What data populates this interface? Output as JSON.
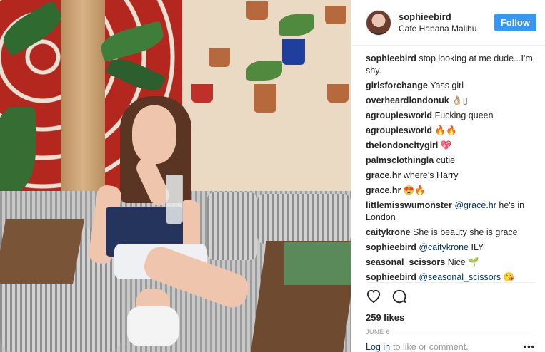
{
  "header": {
    "username": "sophieebird",
    "location": "Cafe Habana Malibu",
    "follow_label": "Follow"
  },
  "comments": [
    {
      "user": "sophieebird",
      "text": "stop looking at me dude...I'm shy."
    },
    {
      "user": "girlsforchange",
      "text": "Yass girl"
    },
    {
      "user": "overheardlondonuk",
      "text": "👌🏼▯"
    },
    {
      "user": "agroupiesworld",
      "text": "Fucking queen"
    },
    {
      "user": "agroupiesworld",
      "text": "🔥🔥"
    },
    {
      "user": "thelondoncitygirl",
      "text": "💖"
    },
    {
      "user": "palmsclothingla",
      "text": "cutie"
    },
    {
      "user": "grace.hr",
      "text": "where's Harry"
    },
    {
      "user": "grace.hr",
      "text": "😍🔥"
    },
    {
      "user": "littlemisswumonster",
      "mention": "@grace.hr",
      "text": "he's in London"
    },
    {
      "user": "caitykrone",
      "text": "She is beauty she is grace"
    },
    {
      "user": "sophieebird",
      "mention": "@caitykrone",
      "text": "ILY"
    },
    {
      "user": "seasonal_scissors",
      "text": "Nice 🌱"
    },
    {
      "user": "sophieebird",
      "mention": "@seasonal_scissors",
      "text": "😘"
    }
  ],
  "actions": {
    "likes": "259 likes",
    "date": "JUNE 6"
  },
  "footer": {
    "login_link": "Log in",
    "login_text": "to like or comment.",
    "more": "•••"
  },
  "colors": {
    "follow_bg": "#3897f0",
    "mention": "#003569"
  }
}
